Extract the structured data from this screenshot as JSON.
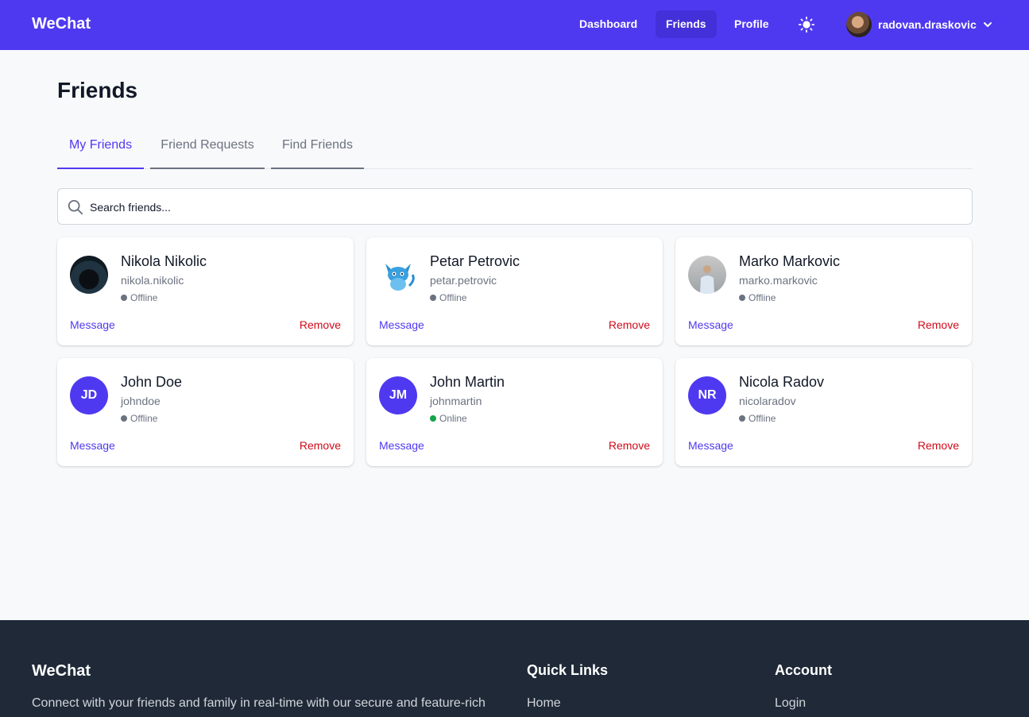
{
  "app": {
    "brand": "WeChat"
  },
  "nav": {
    "links": [
      {
        "label": "Dashboard"
      },
      {
        "label": "Friends"
      },
      {
        "label": "Profile"
      }
    ],
    "user": {
      "username": "radovan.draskovic"
    }
  },
  "page": {
    "title": "Friends",
    "tabs": [
      {
        "label": "My Friends",
        "active": true
      },
      {
        "label": "Friend Requests",
        "active": false
      },
      {
        "label": "Find Friends",
        "active": false
      }
    ],
    "search": {
      "placeholder": "Search friends..."
    },
    "friends": [
      {
        "name": "Nikola Nikolic",
        "username": "nikola.nikolic",
        "status": "Offline",
        "avatar": "hooded-figure-photo",
        "message_label": "Message",
        "remove_label": "Remove"
      },
      {
        "name": "Petar Petrovic",
        "username": "petar.petrovic",
        "status": "Offline",
        "avatar": "blue-fox-illustration",
        "message_label": "Message",
        "remove_label": "Remove"
      },
      {
        "name": "Marko Markovic",
        "username": "marko.markovic",
        "status": "Offline",
        "avatar": "person-photo",
        "message_label": "Message",
        "remove_label": "Remove"
      },
      {
        "name": "John Doe",
        "username": "johndoe",
        "status": "Offline",
        "initials": "JD",
        "message_label": "Message",
        "remove_label": "Remove"
      },
      {
        "name": "John Martin",
        "username": "johnmartin",
        "status": "Online",
        "initials": "JM",
        "message_label": "Message",
        "remove_label": "Remove"
      },
      {
        "name": "Nicola Radov",
        "username": "nicolaradov",
        "status": "Offline",
        "initials": "NR",
        "message_label": "Message",
        "remove_label": "Remove"
      }
    ]
  },
  "footer": {
    "brand": "WeChat",
    "description": "Connect with your friends and family in real-time with our secure and feature-rich",
    "quick_links": {
      "heading": "Quick Links",
      "items": [
        "Home"
      ]
    },
    "account": {
      "heading": "Account",
      "items": [
        "Login"
      ]
    }
  },
  "colors": {
    "primary": "#4f39f0",
    "danger": "#d00b1a",
    "online": "#16a34a",
    "offline": "#6b7280",
    "footer_bg": "#1f2937"
  },
  "icons": [
    "sun-icon",
    "chevron-down-icon",
    "search-icon"
  ]
}
